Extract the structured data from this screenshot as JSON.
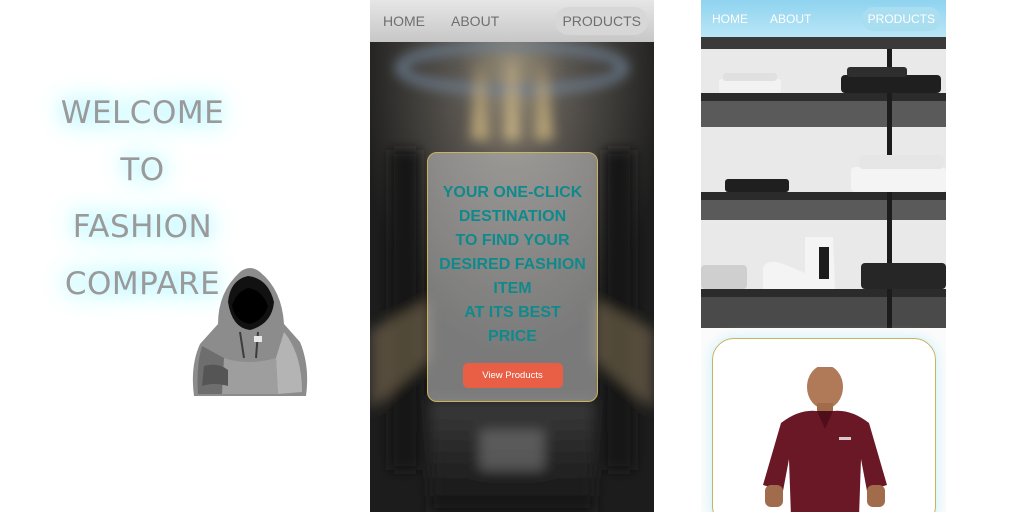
{
  "welcome": {
    "lines": [
      "WELCOME",
      "TO",
      "FASHION",
      "COMPARE"
    ]
  },
  "screen_hero": {
    "nav": {
      "home": "HOME",
      "about": "ABOUT",
      "products": "PRODUCTS"
    },
    "headline": [
      "YOUR ONE-CLICK",
      "DESTINATION",
      "TO FIND YOUR",
      "DESIRED FASHION",
      "ITEM",
      "AT ITS BEST",
      "PRICE"
    ],
    "button_label": "View Products"
  },
  "screen_products": {
    "nav": {
      "home": "HOME",
      "about": "ABOUT",
      "products": "PRODUCTS"
    }
  },
  "colors": {
    "headline": "#0f8a8c",
    "button": "#e95f45",
    "card_border": "#c9b45a",
    "welcome_text": "#9a9a9a",
    "welcome_glow": "#9ff0ff",
    "nav_blue": "#8fd3ef"
  },
  "icons": [
    "hoodie-figure-illustration",
    "hero-background-photo",
    "clothing-shelf-photo",
    "polo-shirt-model-photo"
  ]
}
